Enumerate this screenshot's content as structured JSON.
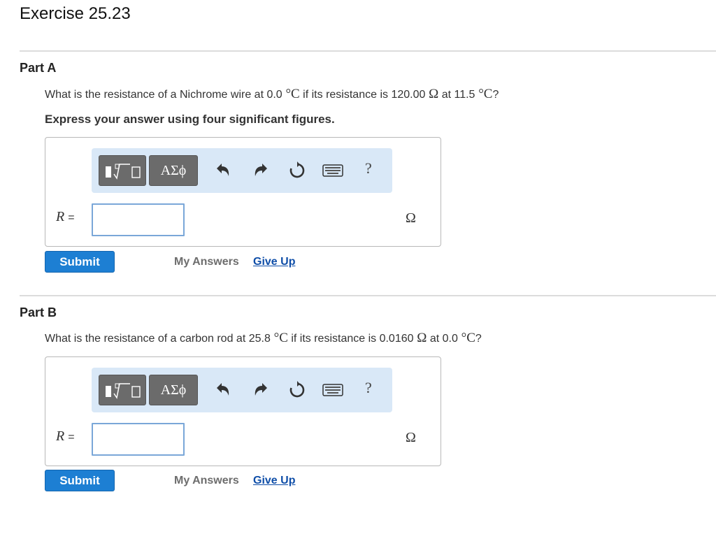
{
  "exercise_title": "Exercise 25.23",
  "colors": {
    "accent": "#1d7fd3",
    "link": "#0f4ea8",
    "toolbar_bg": "#d9e8f7",
    "divider": "#dcdcdc"
  },
  "toolbar_icons": [
    "templates-icon",
    "greek-letters-icon",
    "undo-icon",
    "redo-icon",
    "reset-icon",
    "keyboard-icon",
    "help-icon"
  ],
  "part_a": {
    "title": "Part A",
    "question": {
      "t1": "What is the resistance of a Nichrome wire at 0.0",
      "u1": " °C",
      "t2": " if its resistance is 120.00",
      "u2": " Ω",
      "t3": " at 11.5",
      "u3": " °C",
      "t4": "?"
    },
    "instruction": "Express your answer using four significant figures.",
    "greek_label": "ΑΣϕ",
    "help_label": "?",
    "variable": "R",
    "equals": "=",
    "input_value": "",
    "unit": "Ω",
    "submit_label": "Submit",
    "my_answers_label": "My Answers",
    "give_up_label": "Give Up"
  },
  "part_b": {
    "title": "Part B",
    "question": {
      "t1": "What is the resistance of a carbon rod at 25.8",
      "u1": " °C",
      "t2": " if its resistance is 0.0160",
      "u2": " Ω",
      "t3": " at 0.0",
      "u3": " °C",
      "t4": "?"
    },
    "greek_label": "ΑΣϕ",
    "help_label": "?",
    "variable": "R",
    "equals": "=",
    "input_value": "",
    "unit": "Ω",
    "submit_label": "Submit",
    "my_answers_label": "My Answers",
    "give_up_label": "Give Up"
  }
}
